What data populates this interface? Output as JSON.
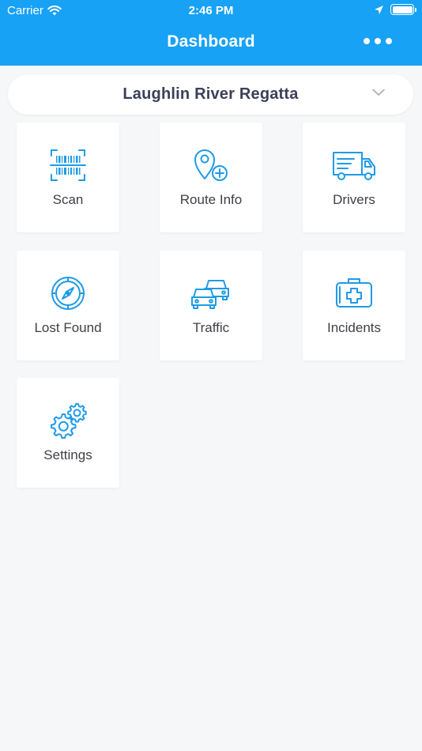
{
  "status_bar": {
    "carrier": "Carrier",
    "time": "2:46 PM"
  },
  "header": {
    "title": "Dashboard",
    "background": "#17a2f5"
  },
  "event_select": {
    "selected": "Laughlin River Regatta"
  },
  "tiles": [
    {
      "label": "Scan",
      "icon": "barcode-scan-icon"
    },
    {
      "label": "Route Info",
      "icon": "map-pin-add-icon"
    },
    {
      "label": "Drivers",
      "icon": "truck-icon"
    },
    {
      "label": "Lost Found",
      "icon": "compass-icon"
    },
    {
      "label": "Traffic",
      "icon": "cars-icon"
    },
    {
      "label": "Incidents",
      "icon": "medical-kit-icon"
    },
    {
      "label": "Settings",
      "icon": "gears-icon"
    }
  ],
  "colors": {
    "icon_blue": "#1e9be8",
    "page_background": "#f6f7f9"
  }
}
